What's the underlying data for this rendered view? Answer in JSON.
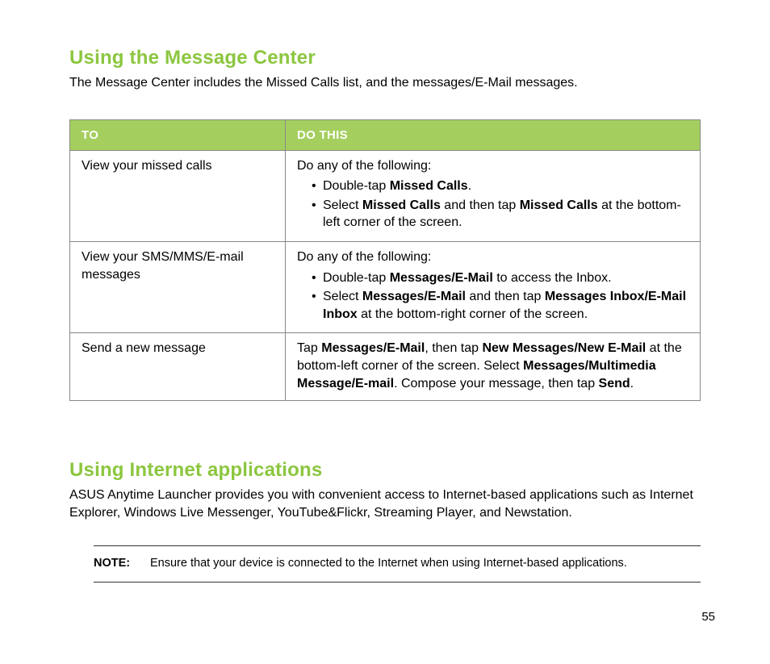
{
  "section1": {
    "heading": "Using the Message Center",
    "intro": "The Message Center includes the Missed Calls list, and the messages/E-Mail messages.",
    "table": {
      "header_to": "TO",
      "header_do": "DO THIS",
      "rows": [
        {
          "to": "View your missed calls",
          "lead": "Do any of the following:",
          "bullets": [
            [
              {
                "t": "Double-tap "
              },
              {
                "b": "Missed Calls"
              },
              {
                "t": "."
              }
            ],
            [
              {
                "t": "Select "
              },
              {
                "b": "Missed Calls"
              },
              {
                "t": " and then tap "
              },
              {
                "b": "Missed Calls"
              },
              {
                "t": " at the bottom-left corner of the screen."
              }
            ]
          ]
        },
        {
          "to": "View your SMS/MMS/E-mail messages",
          "lead": "Do any of the following:",
          "bullets": [
            [
              {
                "t": "Double-tap "
              },
              {
                "b": "Messages/E-Mail"
              },
              {
                "t": " to access the Inbox."
              }
            ],
            [
              {
                "t": "Select "
              },
              {
                "b": "Messages/E-Mail"
              },
              {
                "t": " and then tap "
              },
              {
                "b": "Messages Inbox/E-Mail Inbox"
              },
              {
                "t": " at the bottom-right corner of the screen."
              }
            ]
          ]
        },
        {
          "to": "Send a new message",
          "para": [
            {
              "t": "Tap "
            },
            {
              "b": "Messages/E-Mail"
            },
            {
              "t": ", then tap "
            },
            {
              "b": "New Messages/New E-Mail"
            },
            {
              "t": " at the bottom-left corner of the screen. Select "
            },
            {
              "b": "Messages/Multimedia Message/E-mail"
            },
            {
              "t": ". Compose your message, then tap "
            },
            {
              "b": "Send"
            },
            {
              "t": "."
            }
          ]
        }
      ]
    }
  },
  "section2": {
    "heading": "Using Internet applications",
    "intro": "ASUS Anytime Launcher provides you with convenient access to Internet-based applications such as Internet Explorer, Windows Live Messenger, YouTube&Flickr, Streaming Player, and Newstation.",
    "note_label": "NOTE",
    "note_text": "Ensure that your device is connected to the Internet when using Internet-based applications."
  },
  "page_number": "55"
}
